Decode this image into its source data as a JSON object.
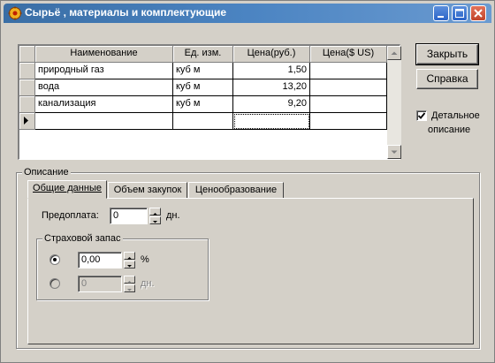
{
  "window": {
    "title": "Сырьё , материалы и комплектующие"
  },
  "grid": {
    "columns": [
      "Наименование",
      "Ед. изм.",
      "Цена(руб.)",
      "Цена($ US)"
    ],
    "rows": [
      [
        "природный газ",
        "куб м",
        "1,50",
        ""
      ],
      [
        "вода",
        "куб м",
        "13,20",
        ""
      ],
      [
        "канализация",
        "куб м",
        "9,20",
        ""
      ],
      [
        "",
        "",
        "",
        ""
      ]
    ]
  },
  "buttons": {
    "close": "Закрыть",
    "help": "Справка"
  },
  "detail_checkbox": {
    "label_line1": "Детальное",
    "label_line2": "описание",
    "checked": true
  },
  "description": {
    "group_label": "Описание",
    "tabs": [
      "Общие данные",
      "Объем закупок",
      "Ценообразование"
    ],
    "prepayment": {
      "label": "Предоплата:",
      "value": "0",
      "unit": "дн."
    },
    "reserve": {
      "label": "Страховой запас",
      "percent_value": "0,00",
      "percent_unit": "%",
      "days_value": "0",
      "days_unit": "дн."
    }
  }
}
